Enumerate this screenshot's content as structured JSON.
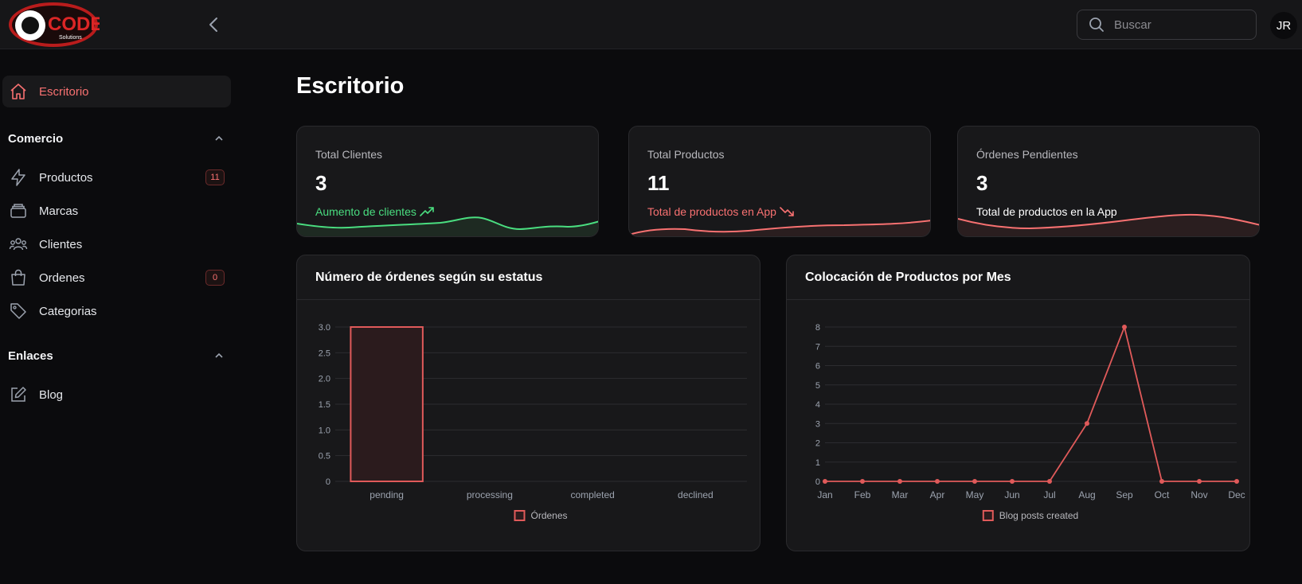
{
  "header": {
    "logo_text": "CODE",
    "logo_subtext": "Solutions",
    "search_placeholder": "Buscar",
    "avatar_initials": "JR"
  },
  "sidebar": {
    "active": {
      "label": "Escritorio",
      "icon": "home-icon"
    },
    "groups": [
      {
        "title": "Comercio",
        "items": [
          {
            "label": "Productos",
            "icon": "bolt-icon",
            "badge": "11"
          },
          {
            "label": "Marcas",
            "icon": "stack-icon"
          },
          {
            "label": "Clientes",
            "icon": "users-icon"
          },
          {
            "label": "Ordenes",
            "icon": "shopping-bag-icon",
            "badge": "0"
          },
          {
            "label": "Categorias",
            "icon": "tag-icon"
          }
        ]
      },
      {
        "title": "Enlaces",
        "items": [
          {
            "label": "Blog",
            "icon": "edit-icon"
          }
        ]
      }
    ]
  },
  "page": {
    "title": "Escritorio"
  },
  "stats": [
    {
      "label": "Total Clientes",
      "value": "3",
      "description": "Aumento de clientes",
      "trend": "up",
      "color": "#4ade80"
    },
    {
      "label": "Total Productos",
      "value": "11",
      "description": "Total de productos en App",
      "trend": "down",
      "color": "#f87171"
    },
    {
      "label": "Órdenes Pendientes",
      "value": "3",
      "description": "Total de productos en la App",
      "trend": "none",
      "color": "#ffffff"
    }
  ],
  "charts": {
    "orders": {
      "title": "Número de órdenes según su estatus",
      "legend": "Órdenes"
    },
    "products": {
      "title": "Colocación de Productos por Mes",
      "legend": "Blog posts created"
    }
  },
  "chart_data": [
    {
      "type": "bar",
      "title": "Número de órdenes según su estatus",
      "categories": [
        "pending",
        "processing",
        "completed",
        "declined"
      ],
      "series": [
        {
          "name": "Órdenes",
          "values": [
            3,
            0,
            0,
            0
          ]
        }
      ],
      "yticks": [
        "0",
        "0.5",
        "1.0",
        "1.5",
        "2.0",
        "2.5",
        "3.0"
      ],
      "ylim": [
        0,
        3
      ],
      "grid": true,
      "legend_position": "bottom",
      "color": "#e05a5a"
    },
    {
      "type": "line",
      "title": "Colocación de Productos por Mes",
      "categories": [
        "Jan",
        "Feb",
        "Mar",
        "Apr",
        "May",
        "Jun",
        "Jul",
        "Aug",
        "Sep",
        "Oct",
        "Nov",
        "Dec"
      ],
      "series": [
        {
          "name": "Blog posts created",
          "values": [
            0,
            0,
            0,
            0,
            0,
            0,
            0,
            3,
            8,
            0,
            0,
            0
          ]
        }
      ],
      "yticks": [
        "0",
        "1",
        "2",
        "3",
        "4",
        "5",
        "6",
        "7",
        "8"
      ],
      "ylim": [
        0,
        8
      ],
      "grid": true,
      "legend_position": "bottom",
      "color": "#e05a5a"
    }
  ]
}
